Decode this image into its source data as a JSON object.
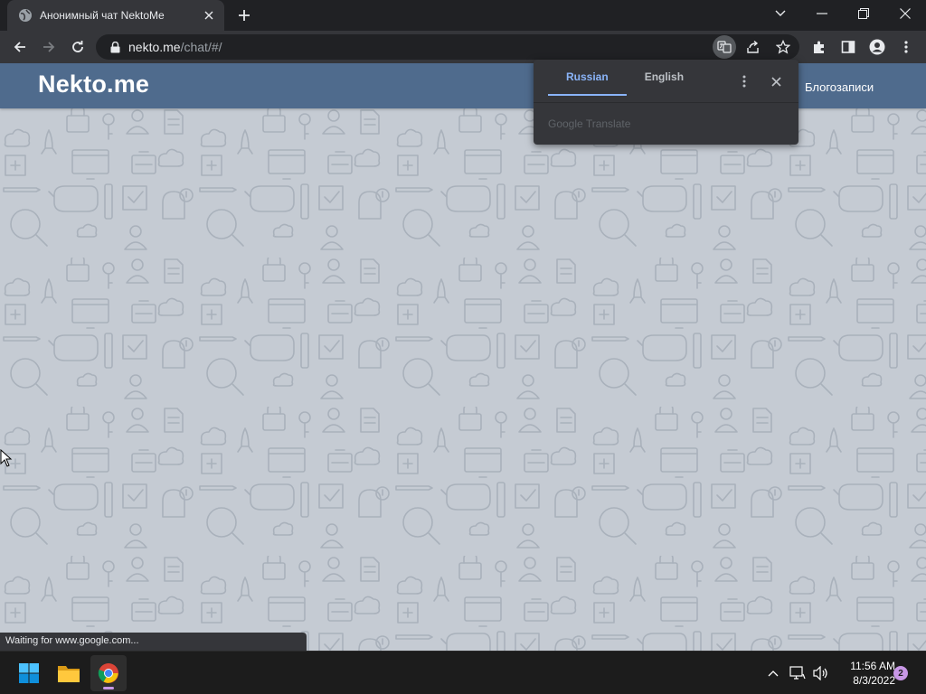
{
  "browser": {
    "tab_title": "Анонимный чат NektoMe",
    "url_host": "nekto.me",
    "url_path": "/chat/#/"
  },
  "site": {
    "logo": "Nekto.me",
    "nav_blog": "Блогозаписи"
  },
  "translate_popup": {
    "tabs": [
      {
        "label": "Russian",
        "active": true
      },
      {
        "label": "English",
        "active": false
      }
    ],
    "brand": "Google Translate"
  },
  "status_bar": {
    "text": "Waiting for www.google.com..."
  },
  "taskbar": {
    "time": "11:56 AM",
    "date": "8/3/2022",
    "notification_count": "2"
  },
  "colors": {
    "header": "#4f6b8d",
    "page_background": "#c5cbd3",
    "accent_blue": "#8ab4f8",
    "badge": "#c897e6"
  }
}
